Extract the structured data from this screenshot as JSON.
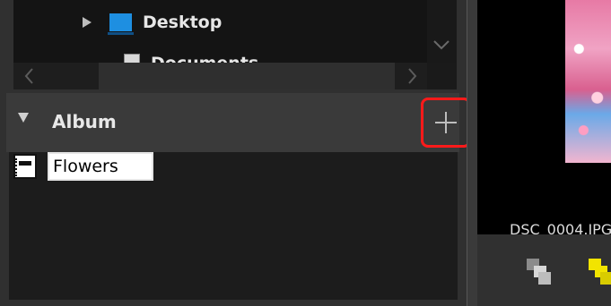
{
  "folder_tree": {
    "items": [
      {
        "label": "Desktop",
        "icon": "desktop-folder-icon",
        "expandable": true
      },
      {
        "label": "Documents",
        "icon": "documents-icon",
        "partially_visible": true
      }
    ]
  },
  "album_section": {
    "title": "Album",
    "add_button_icon": "plus-icon",
    "highlight_color": "#ff1a1a",
    "items": [
      {
        "icon": "album-icon",
        "name_input_value": "Flowers",
        "editing": true
      }
    ]
  },
  "viewer": {
    "filename": "DSC_0004.JPG",
    "toolbar_icons": [
      "stack-icon",
      "highlight-stack-icon"
    ]
  }
}
